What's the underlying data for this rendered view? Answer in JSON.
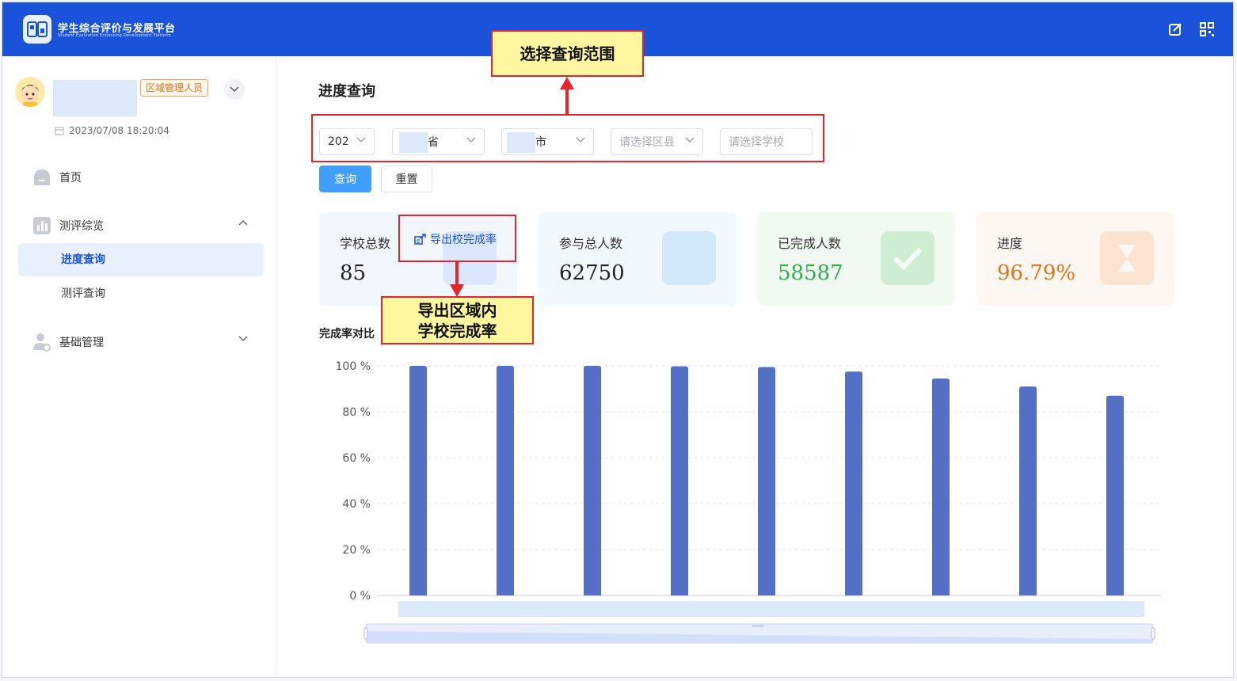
{
  "header": {
    "brand_title": "学生综合评价与发展平台",
    "brand_subtitle": "Student Evaluation Enhancing Development Platform",
    "icons": [
      "edit-icon",
      "qrcode-icon"
    ]
  },
  "user": {
    "role": "区域管理人员",
    "login_time": "2023/07/08 18:20:04"
  },
  "nav": {
    "home": "首页",
    "evaluation_overview": "测评综览",
    "progress_query": "进度查询",
    "evaluation_query": "测评查询",
    "base_management": "基础管理"
  },
  "main": {
    "page_title": "进度查询",
    "filters": {
      "year": "202",
      "province": "省",
      "city": "市",
      "district_placeholder": "请选择区县",
      "school_placeholder": "请选择学校"
    },
    "buttons": {
      "query": "查询",
      "reset": "重置"
    },
    "stats": [
      {
        "label": "学校总数",
        "value": "85",
        "color": "#222222"
      },
      {
        "label": "参与总人数",
        "value": "62750",
        "color": "#222222"
      },
      {
        "label": "已完成人数",
        "value": "58587",
        "color": "#2fae4a"
      },
      {
        "label": "进度",
        "value": "96.79%",
        "color": "#e0741a"
      }
    ],
    "export_link": "导出校完成率",
    "chart_title": "完成率对比"
  },
  "annotations": {
    "select_range": "选择查询范围",
    "export_note_line1": "导出区域内",
    "export_note_line2": "学校完成率"
  },
  "chart_data": {
    "type": "bar",
    "title": "完成率对比",
    "categories": [
      "",
      "",
      "",
      "",
      "",
      "",
      "",
      "",
      ""
    ],
    "series": [
      {
        "values": [
          100,
          100,
          100,
          99.8,
          99.5,
          97.5,
          94.5,
          91,
          87
        ]
      }
    ],
    "yticks": [
      "0 %",
      "20 %",
      "40 %",
      "60 %",
      "80 %",
      "100 %"
    ],
    "ylim": [
      0,
      100
    ],
    "grid": true,
    "bar_color": "#5470c6"
  }
}
